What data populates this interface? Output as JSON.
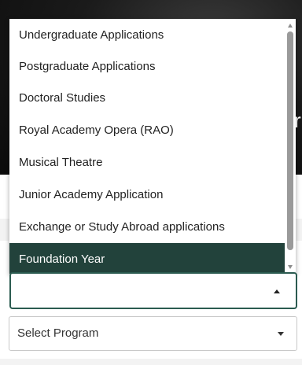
{
  "hero": {
    "partial_text": "r"
  },
  "dropdown": {
    "options": [
      {
        "label": "Undergraduate Applications"
      },
      {
        "label": "Postgraduate Applications"
      },
      {
        "label": "Doctoral Studies"
      },
      {
        "label": "Royal Academy Opera (RAO)"
      },
      {
        "label": "Musical Theatre"
      },
      {
        "label": "Junior Academy Application"
      },
      {
        "label": "Exchange or Study Abroad applications"
      },
      {
        "label": "Foundation Year"
      }
    ],
    "selected_label": "Foundation Year",
    "selected_color": "#22423b",
    "focus_border_color": "#2b5b50",
    "value": ""
  },
  "program_select": {
    "selected_label": "Select Program"
  }
}
